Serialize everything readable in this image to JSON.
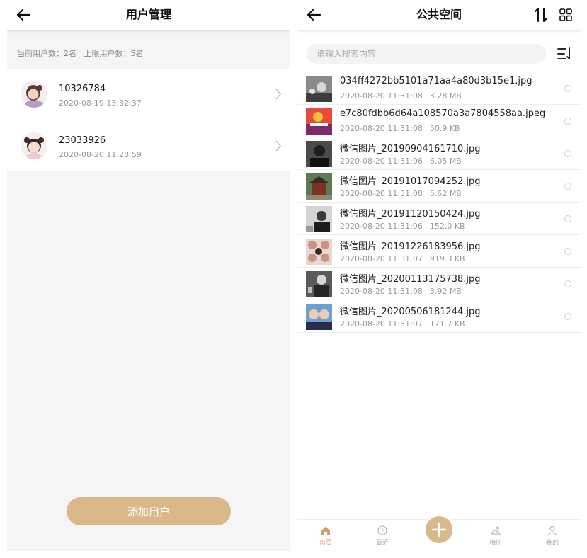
{
  "left": {
    "header": {
      "title": "用户管理"
    },
    "summary": {
      "current": "当前用户数：2名",
      "limit": "上限用户数：5名"
    },
    "users": [
      {
        "id": "10326784",
        "time": "2020-08-19 13:32:37"
      },
      {
        "id": "23033926",
        "time": "2020-08-20 11:28:59"
      }
    ],
    "add_button": "添加用户"
  },
  "right": {
    "header": {
      "title": "公共空间"
    },
    "search": {
      "placeholder": "请输入搜索内容"
    },
    "files": [
      {
        "name": "034ff4272bb5101a71aa4a80d3b15e1.jpg",
        "time": "2020-08-20 11:31:08",
        "size": "3.28 MB"
      },
      {
        "name": "e7c80fdbb6d64a108570a3a7804558aa.jpeg",
        "time": "2020-08-20 11:31:08",
        "size": "50.9 KB"
      },
      {
        "name": "微信图片_20190904161710.jpg",
        "time": "2020-08-20 11:31:06",
        "size": "6.05 MB"
      },
      {
        "name": "微信图片_20191017094252.jpg",
        "time": "2020-08-20 11:31:08",
        "size": "5.62 MB"
      },
      {
        "name": "微信图片_20191120150424.jpg",
        "time": "2020-08-20 11:31:06",
        "size": "152.0 KB"
      },
      {
        "name": "微信图片_20191226183956.jpg",
        "time": "2020-08-20 11:31:07",
        "size": "919.3 KB"
      },
      {
        "name": "微信图片_20200113175738.jpg",
        "time": "2020-08-20 11:31:08",
        "size": "3.92 MB"
      },
      {
        "name": "微信图片_20200506181244.jpg",
        "time": "2020-08-20 11:31:07",
        "size": "171.7 KB"
      }
    ],
    "tabs": [
      {
        "label": "首页",
        "icon": "home-icon",
        "active": true
      },
      {
        "label": "最近",
        "icon": "clock-icon",
        "active": false
      },
      {
        "label": "相册",
        "icon": "album-icon",
        "active": false
      },
      {
        "label": "我的",
        "icon": "profile-icon",
        "active": false
      }
    ]
  },
  "colors": {
    "accent": "#d9b88a",
    "tab_active": "#d4a06a"
  }
}
